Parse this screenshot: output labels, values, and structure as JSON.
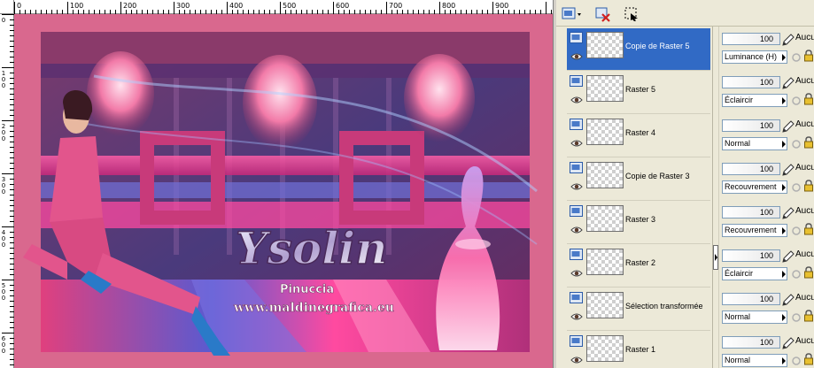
{
  "ruler": {
    "top_labels": [
      "0",
      "100",
      "200",
      "300",
      "400",
      "500",
      "600",
      "700",
      "800",
      "900"
    ],
    "left_labels": [
      "0",
      "1\n0\n0",
      "2\n0\n0",
      "3\n0\n0",
      "4\n0\n0",
      "5\n0\n0",
      "6\n0\n0"
    ]
  },
  "artwork": {
    "title": "Ysolin",
    "author": "Pinuccia",
    "url": "www.maldinegrafica.eu"
  },
  "toolbar": {
    "icons": [
      "new-layer-icon",
      "delete-layer-icon",
      "selection-icon"
    ]
  },
  "layers": [
    {
      "name": "Copie de Raster 5",
      "opacity": "100",
      "blend": "Luminance (H)",
      "auto": "Aucu",
      "selected": true
    },
    {
      "name": "Raster 5",
      "opacity": "100",
      "blend": "Éclaircir",
      "auto": "Aucu",
      "selected": false
    },
    {
      "name": "Raster 4",
      "opacity": "100",
      "blend": "Normal",
      "auto": "Aucu",
      "selected": false
    },
    {
      "name": "Copie de Raster 3",
      "opacity": "100",
      "blend": "Recouvrement",
      "auto": "Aucu",
      "selected": false
    },
    {
      "name": "Raster 3",
      "opacity": "100",
      "blend": "Recouvrement",
      "auto": "Aucu",
      "selected": false
    },
    {
      "name": "Raster 2",
      "opacity": "100",
      "blend": "Éclaircir",
      "auto": "Aucu",
      "selected": false
    },
    {
      "name": "Sélection transformée",
      "opacity": "100",
      "blend": "Normal",
      "auto": "Aucu",
      "selected": false
    },
    {
      "name": "Raster 1",
      "opacity": "100",
      "blend": "Normal",
      "auto": "Aucu",
      "selected": false
    }
  ],
  "colors": {
    "accent_selected": "#316ac5",
    "frame_pink": "#d9688e",
    "panel_bg": "#ece9d8"
  }
}
